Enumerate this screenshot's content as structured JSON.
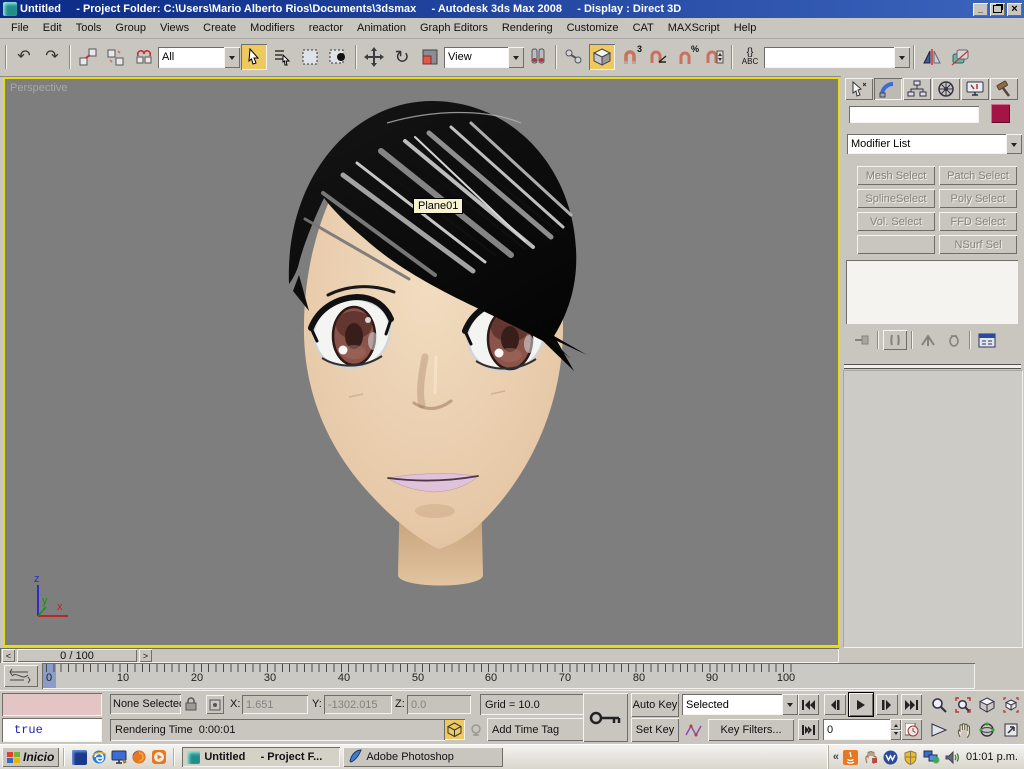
{
  "colors": {
    "titlebar_start": "#0a2a86",
    "titlebar_end": "#3b64bd",
    "ui_gray": "#c9c6c0",
    "viewport_bg": "#7e7e7e",
    "viewport_border": "#e8dc16",
    "active_tool_yellow": "#edc95f",
    "object_color_swatch": "#a21544",
    "listener_pink": "#e3c5c5",
    "frame_marker_blue": "#8a9cc8"
  },
  "titlebar": {
    "title": "Untitled     - Project Folder: C:\\Users\\Mario Alberto Rios\\Documents\\3dsmax     - Autodesk 3ds Max 2008     - Display : Direct 3D"
  },
  "menus": [
    "File",
    "Edit",
    "Tools",
    "Group",
    "Views",
    "Create",
    "Modifiers",
    "reactor",
    "Animation",
    "Graph Editors",
    "Rendering",
    "Customize",
    "CAT",
    "MAXScript",
    "Help"
  ],
  "toolbar": {
    "selection_filter": "All",
    "reference_coordinate": "View",
    "named_selection": "",
    "snap3_label": "3",
    "percent_label": "%",
    "abc_label": "ABC",
    "braces_label": "{}"
  },
  "viewport": {
    "label": "Perspective",
    "tooltip": "Plane01",
    "axis_x": "x",
    "axis_y": "y",
    "axis_z": "z"
  },
  "command_panel": {
    "modifier_list": "Modifier List",
    "selection_buttons": [
      "Mesh Select",
      "Patch Select",
      "SplineSelect",
      "Poly Select",
      "Vol. Select",
      "FFD Select",
      "",
      "NSurf Sel"
    ]
  },
  "time_controls": {
    "time_slider": "0 / 100",
    "prev_glyph": "<",
    "next_glyph": ">",
    "frame_field": "0",
    "track_labels": [
      "0",
      "10",
      "20",
      "30",
      "40",
      "50",
      "60",
      "70",
      "80",
      "90",
      "100"
    ]
  },
  "status_bar": {
    "selection_status": "None Selected",
    "x_label": "X:",
    "x_value": "1.651",
    "y_label": "Y:",
    "y_value": "-1302.015",
    "z_label": "Z:",
    "z_value": "0.0",
    "grid": "Grid = 10.0",
    "prompt": "Rendering Time  0:00:01",
    "add_time_tag": "Add Time Tag",
    "listener_result": "true",
    "auto_key": "Auto Key",
    "set_key": "Set Key",
    "key_mode": "Selected",
    "key_filters": "Key Filters..."
  },
  "taskbar": {
    "start": "Inicio",
    "task1": "Untitled     - Project F...",
    "task2": "Adobe Photoshop",
    "tray_chevron": "«",
    "clock": "01:01 p.m."
  },
  "glyphs": {
    "undo": "↶",
    "redo": "↷",
    "rotate": "↻",
    "close": "×",
    "min": "_"
  }
}
